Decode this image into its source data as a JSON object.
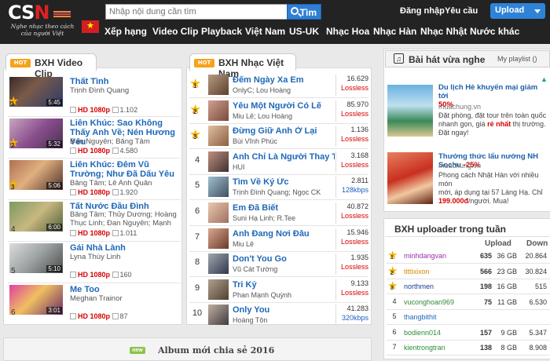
{
  "logo": {
    "main": "CSN",
    "accent": "N",
    "tagline_1": "Nghe nhạc theo cách",
    "tagline_2": "của người Việt"
  },
  "search": {
    "placeholder": "Nhập nội dung cần tìm",
    "button_label": "Tìm"
  },
  "header": {
    "login_label": "Đăng nhập",
    "request_label": "Yêu cầu",
    "upload_label": "Upload"
  },
  "nav": {
    "items": [
      "Xếp hạng",
      "Video Clip",
      "Playback",
      "Việt Nam",
      "US-UK",
      "Nhạc Hoa",
      "Nhạc Hàn",
      "Nhạc Nhật",
      "Nước khác"
    ]
  },
  "video_chart": {
    "title": "BXH Video Clip",
    "hot_label": "HOT",
    "items": [
      {
        "rank": "1",
        "title": "Thất Tình",
        "artist": "Trịnh Đình Quang",
        "artist2": "",
        "duration": "5:45",
        "quality": "HD 1080p",
        "views": "1.102"
      },
      {
        "rank": "2",
        "title": "Liên Khúc: Sao Không Thấy Anh Về; Nén Hương Yêu",
        "artist": "Đan Nguyên; Băng Tâm",
        "artist2": "",
        "duration": "5:32",
        "quality": "HD 1080p",
        "views": "4.580"
      },
      {
        "rank": "3",
        "title": "Liên Khúc: Đêm Vũ Trường; Như Đã Dấu Yêu",
        "artist": "Băng Tâm; Lê Anh Quân",
        "artist2": "",
        "duration": "5:06",
        "quality": "HD 1080p",
        "views": "1.920"
      },
      {
        "rank": "4",
        "title": "Tất Nước Đầu Đình",
        "artist": "Băng Tâm; Thủy Dương; Hoàng",
        "artist2": "Thục Linh; Đan Nguyên; Mạnh",
        "duration": "6:00",
        "quality": "HD 1080p",
        "views": "1.011"
      },
      {
        "rank": "5",
        "title": "Gái Nhà Lành",
        "artist": "Lyna Thùy Linh",
        "artist2": "",
        "duration": "5:10",
        "quality": "HD 1080p",
        "views": "160"
      },
      {
        "rank": "6",
        "title": "Me Too",
        "artist": "Meghan Trainor",
        "artist2": "",
        "duration": "3:01",
        "quality": "HD 1080p",
        "views": "87"
      }
    ]
  },
  "song_chart": {
    "title": "BXH Nhạc Việt Nam",
    "hot_label": "HOT",
    "items": [
      {
        "rank": "1",
        "title": "Đếm Ngày Xa Em",
        "artist": "OnlyC; Lou Hoàng",
        "count": "16.629",
        "quality": "Lossless"
      },
      {
        "rank": "2",
        "title": "Yêu Một Người Có Lẽ",
        "artist": "Miu Lê; Lou Hoàng",
        "count": "85.970",
        "quality": "Lossless"
      },
      {
        "rank": "3",
        "title": "Đừng Giữ Anh Ở Lại",
        "artist": "Bùi Vĩnh Phúc",
        "count": "1.136",
        "quality": "Lossless"
      },
      {
        "rank": "4",
        "title": "Anh Chỉ Là Người Thay Thế",
        "artist": "HUI",
        "count": "3.168",
        "quality": "Lossless"
      },
      {
        "rank": "5",
        "title": "Tìm Về Ký Ức",
        "artist": "Trịnh Đình Quang; Ngọc CK",
        "count": "2.811",
        "quality": "128kbps"
      },
      {
        "rank": "6",
        "title": "Em Đã Biết",
        "artist": "Suni Hạ Linh; R.Tee",
        "count": "40.872",
        "quality": "Lossless"
      },
      {
        "rank": "7",
        "title": "Anh Đang Nơi Đâu",
        "artist": "Miu Lê",
        "count": "15.946",
        "quality": "Lossless"
      },
      {
        "rank": "8",
        "title": "Don't You Go",
        "artist": "Vũ Cát Tường",
        "count": "1.935",
        "quality": "Lossless"
      },
      {
        "rank": "9",
        "title": "Tri Kỷ",
        "artist": "Phan Mạnh Quỳnh",
        "count": "9.133",
        "quality": "Lossless"
      },
      {
        "rank": "10",
        "title": "Only You",
        "artist": "Hoàng Tôn",
        "count": "41.283",
        "quality": "320kbps"
      }
    ]
  },
  "recent": {
    "title": "Bài hát vừa nghe",
    "playlist_label": "My playlist ()"
  },
  "ads": [
    {
      "title": "Du lịch Hè khuyến mại giảm tới",
      "discount": "50%",
      "domain": "muachung.vn",
      "desc_1": "Đặt phòng, đặt tour trên toàn quốc",
      "desc_2": "nhanh gọn, giá ",
      "desc_highlight": "rẻ nhất",
      "desc_3": " thị trường.",
      "desc_4": "Đặt ngay!"
    },
    {
      "title": "Thưởng thức lẩu nướng NH Sochu ",
      "discount": "-25%",
      "domain": "muachung.vn",
      "desc_1": "Phong cách Nhật Hàn với nhiều món",
      "desc_2": "mới, áp dụng tại 57 Láng Hạ. Chỉ",
      "desc_highlight": "199.000đ",
      "desc_3": "/người. Mua!",
      "desc_4": ""
    }
  ],
  "uploaders": {
    "title": "BXH uploader trong tuần",
    "col_upload": "Upload",
    "col_download": "Down",
    "rows": [
      {
        "rank": "1",
        "name": "minhdangvan",
        "color": "#9b2fa8",
        "uploads": "635",
        "size": "36 GB",
        "downloads": "20.864"
      },
      {
        "rank": "2",
        "name": "tittixixon",
        "color": "#d68a00",
        "uploads": "566",
        "size": "23 GB",
        "downloads": "30.824"
      },
      {
        "rank": "3",
        "name": "northmen",
        "color": "#1a3c8e",
        "uploads": "198",
        "size": "16 GB",
        "downloads": "515"
      },
      {
        "rank": "4",
        "name": "vuconghoan969",
        "color": "#2e8b3a",
        "uploads": "75",
        "size": "11 GB",
        "downloads": "6.530"
      },
      {
        "rank": "5",
        "name": "thangbithit",
        "color": "#1e68b8",
        "uploads": "",
        "size": "",
        "downloads": ""
      },
      {
        "rank": "6",
        "name": "bodienn014",
        "color": "#2e8b3a",
        "uploads": "157",
        "size": "9 GB",
        "downloads": "5.347"
      },
      {
        "rank": "7",
        "name": "kientrongtran",
        "color": "#2e8b3a",
        "uploads": "138",
        "size": "8 GB",
        "downloads": "8.908"
      }
    ]
  },
  "album_section": {
    "title": "Album mới chia sẻ 2016",
    "new_label": "new"
  },
  "colors": {
    "link": "#1e68b8",
    "hd": "#d60000",
    "accent": "#2f7fd4",
    "header": "#232323"
  }
}
